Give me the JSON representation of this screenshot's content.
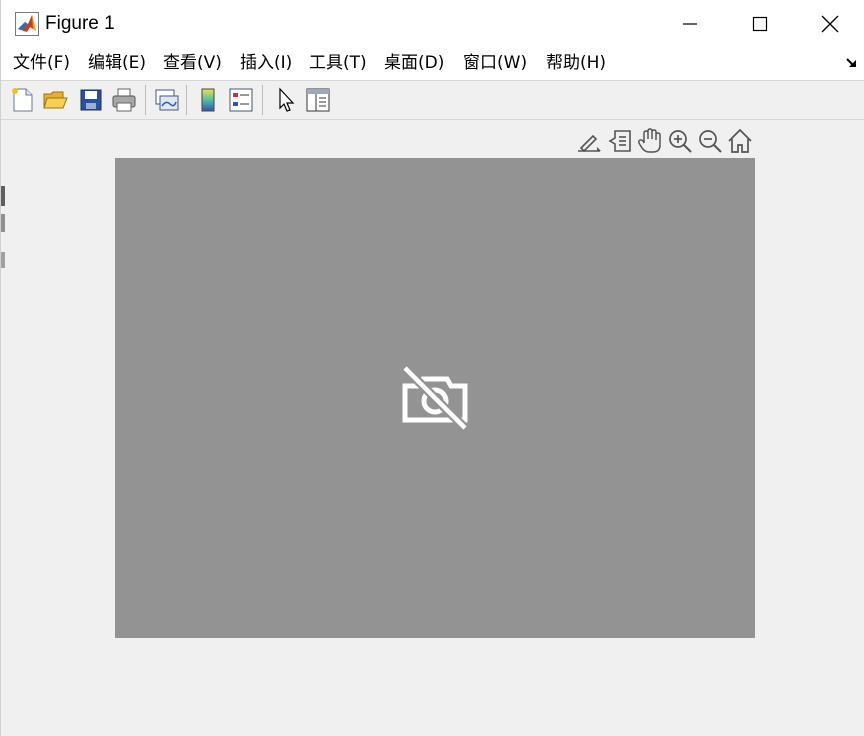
{
  "window": {
    "title": "Figure 1",
    "controls": [
      "minimize",
      "maximize",
      "close"
    ]
  },
  "menu": {
    "items": [
      {
        "label": "文件(F)"
      },
      {
        "label": "编辑(E)"
      },
      {
        "label": "查看(V)"
      },
      {
        "label": "插入(I)"
      },
      {
        "label": "工具(T)"
      },
      {
        "label": "桌面(D)"
      },
      {
        "label": "窗口(W)"
      },
      {
        "label": "帮助(H)"
      }
    ]
  },
  "toolbar": {
    "buttons": [
      "new-figure-icon",
      "open-file-icon",
      "save-icon",
      "print-icon",
      "link-plot-icon",
      "colorbar-icon",
      "legend-icon",
      "select-arrow-icon",
      "property-inspector-icon"
    ]
  },
  "axes_toolbar": {
    "buttons": [
      "brush-icon",
      "data-tips-icon",
      "pan-icon",
      "zoom-in-icon",
      "zoom-out-icon",
      "home-icon"
    ]
  },
  "axes": {
    "background": "#939393",
    "placeholder_icon": "no-camera-icon"
  }
}
